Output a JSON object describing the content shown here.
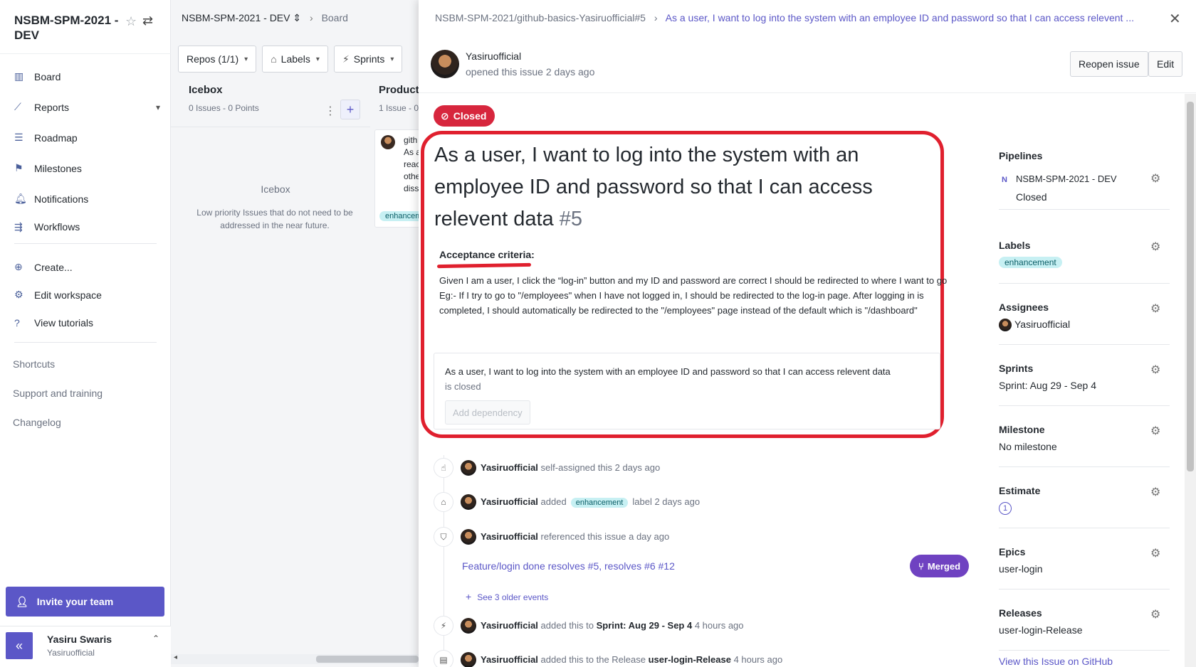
{
  "sidebar": {
    "workspace_name": "NSBM-SPM-2021 - DEV",
    "nav": [
      {
        "label": "Board",
        "icon": "board-icon"
      },
      {
        "label": "Reports",
        "icon": "reports-icon"
      },
      {
        "label": "Roadmap",
        "icon": "roadmap-icon"
      },
      {
        "label": "Milestones",
        "icon": "milestone-icon"
      },
      {
        "label": "Notifications",
        "icon": "bell-icon"
      },
      {
        "label": "Workflows",
        "icon": "workflow-icon"
      }
    ],
    "actions": [
      {
        "label": "Create...",
        "icon": "plus-circle-icon"
      },
      {
        "label": "Edit workspace",
        "icon": "gear-icon"
      },
      {
        "label": "View tutorials",
        "icon": "question-icon"
      }
    ],
    "footer_links": [
      "Shortcuts",
      "Support and training",
      "Changelog"
    ],
    "invite_label": "Invite your team",
    "user": {
      "name": "Yasiru Swaris",
      "login": "Yasiruofficial"
    }
  },
  "board": {
    "breadcrumb": {
      "workspace": "NSBM-SPM-2021 - DEV",
      "page": "Board"
    },
    "filters": [
      {
        "label": "Repos (1/1)",
        "icon": "repo-icon"
      },
      {
        "label": "Labels",
        "icon": "tag-icon"
      },
      {
        "label": "Sprints",
        "icon": "sprint-icon"
      }
    ],
    "columns": [
      {
        "title": "Icebox",
        "meta": "0 Issues - 0 Points"
      },
      {
        "title": "Product",
        "meta": "1 Issue - 0"
      }
    ],
    "empty": {
      "title": "Icebox",
      "description": "Low priority Issues that do not need to be addressed in the near future."
    },
    "mini_card": {
      "lines": [
        "gith",
        "As a",
        "reac",
        "othe",
        "diss"
      ],
      "label": "enhancem"
    }
  },
  "issue": {
    "repo_ref": "NSBM-SPM-2021/github-basics-Yasiruofficial#5",
    "title_short": "As a user, I want to log into the system with an employee ID and password so that I can access relevent ...",
    "author": "Yasiruofficial",
    "opened": "opened this issue 2 days ago",
    "reopen_label": "Reopen issue",
    "edit_label": "Edit",
    "state": "Closed",
    "title": "As a user, I want to log into the system with an employee ID and password so that I can access relevent data",
    "number": "#5",
    "acceptance_label": "Acceptance criteria:",
    "body_line1": "Given I am a user, I click the “log-in” button and my ID and password are correct I should be redirected to where I want to go",
    "body_line2": "Eg:- If I try to go to \"/employees\" when I have not logged in, I should be redirected to the log-in page. After logging in is completed, I should automatically be redirected to the \"/employees\" page instead of the default which is \"/dashboard\"",
    "dependency": {
      "title": "As a user, I want to log into the system with an employee ID and password so that I can access relevent data",
      "status": "is closed",
      "button": "Add dependency"
    },
    "timeline": [
      {
        "who": "Yasiruofficial",
        "pre": "self-assigned this 2 days ago",
        "icon": "assign-icon"
      },
      {
        "who": "Yasiruofficial",
        "pre": "added",
        "label": "enhancement",
        "post": "label 2 days ago",
        "icon": "tag-icon"
      },
      {
        "who": "Yasiruofficial",
        "pre": "referenced this issue a day ago",
        "icon": "shield-icon"
      },
      {
        "who": "Yasiruofficial",
        "pre": "added this to",
        "strong": "Sprint: Aug 29 - Sep 4",
        "post": "4 hours ago",
        "icon": "sprint-icon"
      },
      {
        "who": "Yasiruofficial",
        "pre": "added this to the Release",
        "strong": "user-login-Release",
        "post": "4 hours ago",
        "icon": "document-icon"
      }
    ],
    "pr": {
      "title": "Feature/login done resolves #5, resolves #6 #12",
      "state": "Merged"
    },
    "older_events": "See 3 older events"
  },
  "meta": {
    "pipelines": {
      "title": "Pipelines",
      "workspace": "NSBM-SPM-2021 - DEV",
      "status": "Closed",
      "chip": "N"
    },
    "labels": {
      "title": "Labels",
      "value": "enhancement"
    },
    "assignees": {
      "title": "Assignees",
      "value": "Yasiruofficial"
    },
    "sprints": {
      "title": "Sprints",
      "value": "Sprint: Aug 29 - Sep 4"
    },
    "milestone": {
      "title": "Milestone",
      "value": "No milestone"
    },
    "estimate": {
      "title": "Estimate",
      "value": "1"
    },
    "epics": {
      "title": "Epics",
      "value": "user-login"
    },
    "releases": {
      "title": "Releases",
      "value": "user-login-Release"
    },
    "github_link": "View this Issue on GitHub"
  },
  "colors": {
    "accent": "#5b57c7",
    "closed": "#d7263d",
    "merged": "#6f42c1",
    "highlight": "#e0202e",
    "label_bg": "#c7f0f3"
  }
}
